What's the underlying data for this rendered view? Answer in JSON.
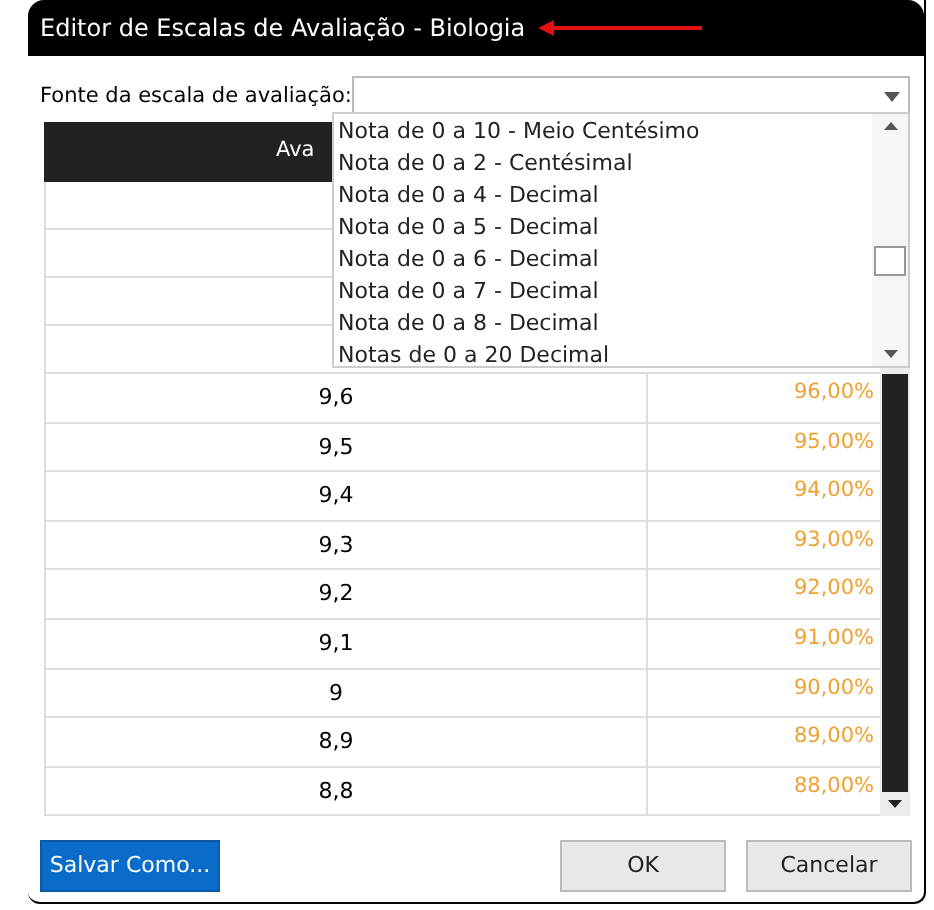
{
  "window": {
    "title": "Editor de Escalas de Avaliação - Biologia"
  },
  "source_field": {
    "label": "Fonte da escala de avaliação:",
    "options": [
      "Nota de 0 a 10 - Meio Centésimo",
      "Nota de 0 a 2 - Centésimal",
      "Nota de 0 a 4 - Decimal",
      "Nota de 0 a 5 - Decimal",
      "Nota de 0 a 6 - Decimal",
      "Nota de 0 a 7 - Decimal",
      "Nota de 0 a 8 - Decimal",
      "Notas de 0 a 20 Decimal"
    ]
  },
  "table": {
    "columns": [
      "Ava"
    ],
    "rows": [
      {
        "grade": "9,6",
        "percent": "96,00%"
      },
      {
        "grade": "9,5",
        "percent": "95,00%"
      },
      {
        "grade": "9,4",
        "percent": "94,00%"
      },
      {
        "grade": "9,3",
        "percent": "93,00%"
      },
      {
        "grade": "9,2",
        "percent": "92,00%"
      },
      {
        "grade": "9,1",
        "percent": "91,00%"
      },
      {
        "grade": "9",
        "percent": "90,00%"
      },
      {
        "grade": "8,9",
        "percent": "89,00%"
      },
      {
        "grade": "8,8",
        "percent": "88,00%"
      }
    ]
  },
  "buttons": [
    {
      "label": "Salvar Como...",
      "kind": "primary"
    },
    {
      "label": "OK",
      "kind": "default"
    },
    {
      "label": "Cancelar",
      "kind": "default"
    }
  ]
}
